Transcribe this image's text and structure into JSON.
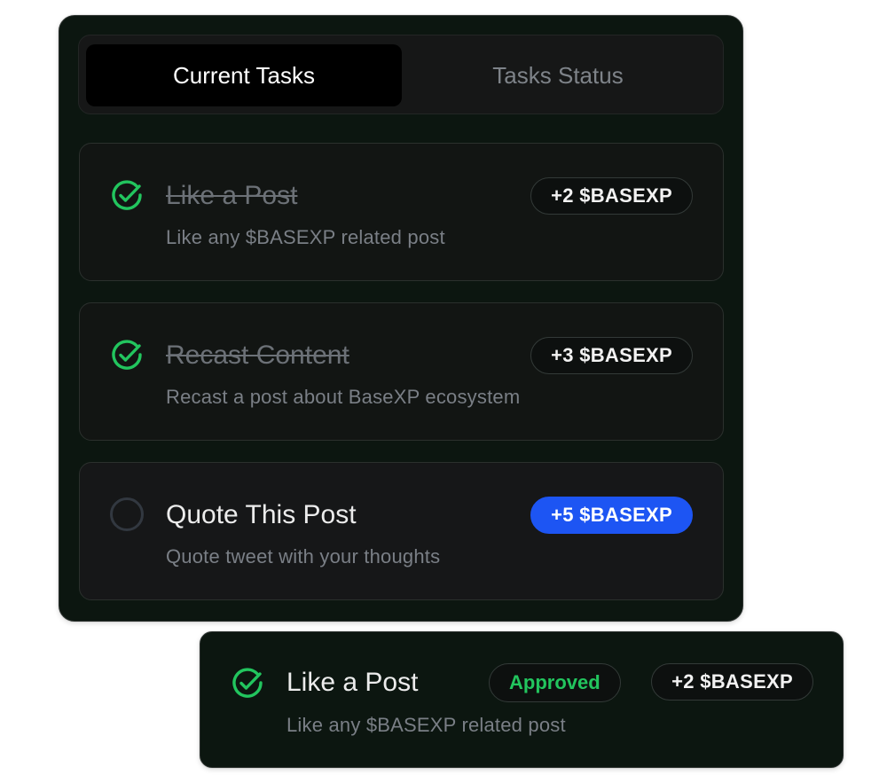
{
  "tabs": {
    "current_label": "Current Tasks",
    "status_label": "Tasks Status"
  },
  "tasks": [
    {
      "title": "Like a Post",
      "description": "Like any $BASEXP related post",
      "reward": "+2 $BASEXP",
      "completed": true,
      "status_icon": "check-circle-icon"
    },
    {
      "title": "Recast Content",
      "description": "Recast a post about BaseXP ecosystem",
      "reward": "+3 $BASEXP",
      "completed": true,
      "status_icon": "check-circle-icon"
    },
    {
      "title": "Quote This Post",
      "description": "Quote tweet with your thoughts",
      "reward": "+5 $BASEXP",
      "completed": false,
      "status_icon": "empty-circle-icon"
    }
  ],
  "status_card": {
    "title": "Like a Post",
    "description": "Like any $BASEXP related post",
    "status": "Approved",
    "reward": "+2 $BASEXP",
    "status_icon": "check-circle-icon"
  },
  "colors": {
    "check_green": "#22c55e",
    "reward_highlight": "#1d55f3",
    "panel_bg": "#0c1610"
  }
}
